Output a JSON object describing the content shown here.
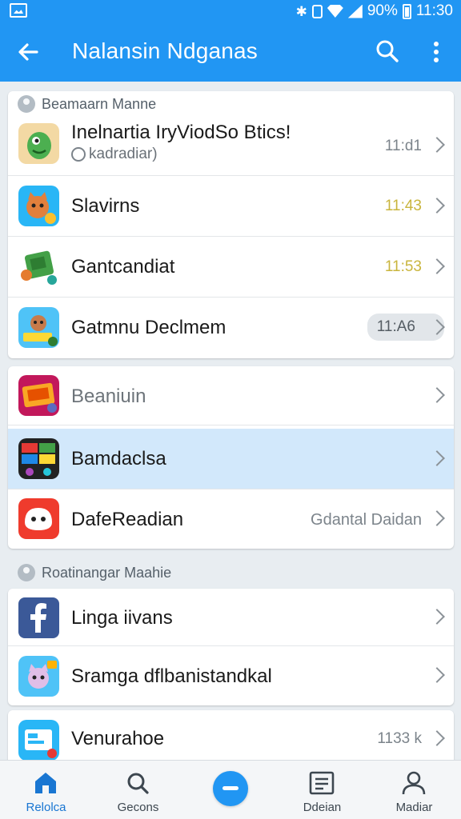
{
  "status_bar": {
    "battery_percent": "90%",
    "time": "11:30",
    "icons": [
      "gallery-icon",
      "bluetooth-icon",
      "vibrate-icon",
      "wifi-icon",
      "signal-icon",
      "battery-icon"
    ]
  },
  "app_bar": {
    "title": "Nalansin Ndganas",
    "back_icon": "back-arrow-icon",
    "search_icon": "search-icon",
    "more_icon": "more-vert-icon",
    "color": "#2196f3"
  },
  "section1": {
    "header": "Beamaarn Manne",
    "rows": [
      {
        "label": "Inelnartia IryViodSo Btics!",
        "sublabel": "kadradiar)",
        "meta": "11:d1",
        "icon": "green-monster-app-icon"
      },
      {
        "label": "Slavirns",
        "meta": "11:43",
        "icon": "cat-game-app-icon"
      },
      {
        "label": "Gantcandiat",
        "meta": "11:53",
        "icon": "green-block-game-app-icon"
      },
      {
        "label": "Gatmnu Declmem",
        "meta": "11:A6",
        "icon": "monkey-game-app-icon"
      }
    ]
  },
  "section2": {
    "rows": [
      {
        "label": "Beaniuin",
        "icon": "board-game-app-icon"
      },
      {
        "label": "Bamdaclsa",
        "icon": "colorful-puzzle-app-icon"
      },
      {
        "label": "DafeReadian",
        "meta": "Gdantal Daidan",
        "icon": "red-face-app-icon"
      }
    ]
  },
  "section3": {
    "header": "Roatinangar Maahie",
    "rows": [
      {
        "label": "Linga iivans",
        "icon": "facebook-icon"
      },
      {
        "label": "Sramga dflbanistandkal",
        "icon": "blue-cat-app-icon"
      }
    ]
  },
  "section4": {
    "rows": [
      {
        "label": "Venurahoe",
        "meta": "1133 k",
        "icon": "blue-card-app-icon"
      }
    ]
  },
  "bottom_nav": [
    {
      "label": "Relolca",
      "icon": "home-icon",
      "active": true
    },
    {
      "label": "Gecons",
      "icon": "search-icon",
      "active": false
    },
    {
      "label": "",
      "icon": "compose-fab-icon",
      "active": false
    },
    {
      "label": "Ddeian",
      "icon": "list-icon",
      "active": false
    },
    {
      "label": "Madiar",
      "icon": "profile-icon",
      "active": false
    }
  ]
}
